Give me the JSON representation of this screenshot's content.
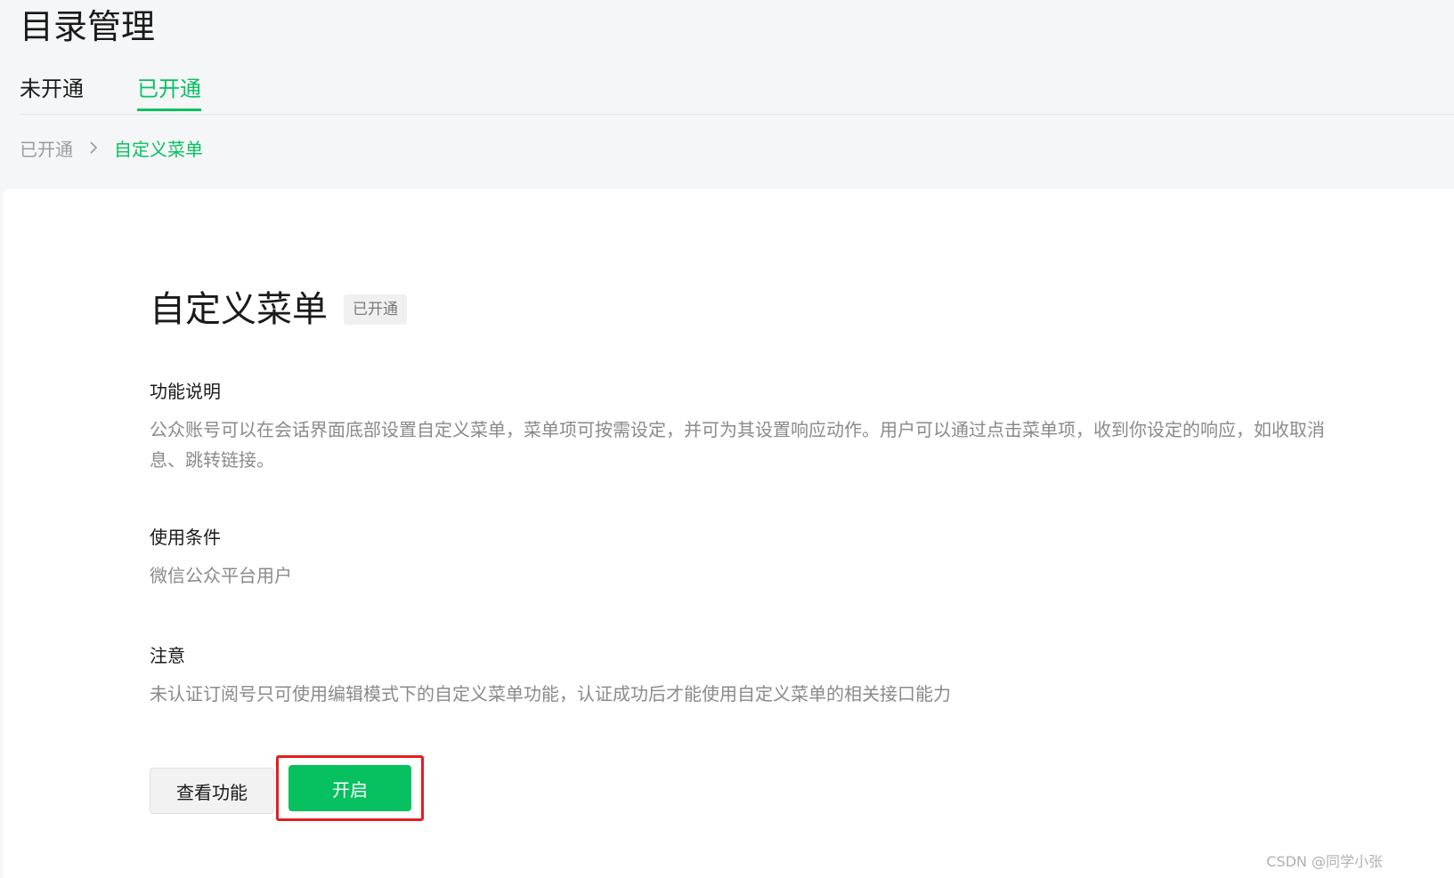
{
  "header": {
    "title": "目录管理"
  },
  "tabs": [
    {
      "label": "未开通",
      "active": false
    },
    {
      "label": "已开通",
      "active": true
    }
  ],
  "breadcrumb": {
    "parent": "已开通",
    "current": "自定义菜单",
    "separator_icon": "chevron-right-icon"
  },
  "feature": {
    "title": "自定义菜单",
    "status_badge": "已开通",
    "sections": [
      {
        "heading": "功能说明",
        "body": "公众账号可以在会话界面底部设置自定义菜单，菜单项可按需设定，并可为其设置响应动作。用户可以通过点击菜单项，收到你设定的响应，如收取消息、跳转链接。"
      },
      {
        "heading": "使用条件",
        "body": "微信公众平台用户"
      },
      {
        "heading": "注意",
        "body": "未认证订阅号只可使用编辑模式下的自定义菜单功能，认证成功后才能使用自定义菜单的相关接口能力"
      }
    ],
    "buttons": {
      "view_label": "查看功能",
      "enable_label": "开启"
    }
  },
  "watermark": "CSDN @同学小张",
  "colors": {
    "accent": "#07c160",
    "highlight": "#e21f1f",
    "page_bg": "#f5f6f7",
    "card_bg": "#ffffff"
  }
}
